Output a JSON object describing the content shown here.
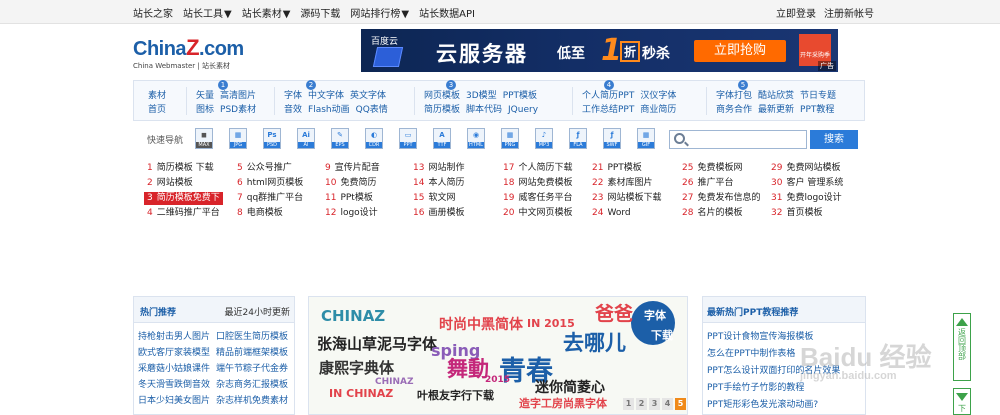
{
  "topnav": {
    "items": [
      {
        "label": "站长之家",
        "dropdown": false
      },
      {
        "label": "站长工具",
        "dropdown": true
      },
      {
        "label": "站长素材",
        "dropdown": true
      },
      {
        "label": "源码下载",
        "dropdown": false
      },
      {
        "label": "网站排行榜",
        "dropdown": true
      },
      {
        "label": "站长数据API",
        "dropdown": false
      }
    ],
    "login": "立即登录",
    "register": "注册新帐号"
  },
  "logo": {
    "main_a": "China",
    "main_z": "Z",
    "main_b": ".com",
    "sub": "China Webmaster | 站长素材"
  },
  "ad": {
    "brand": "百度云",
    "title": "云服务器",
    "low": "低至",
    "num": "1",
    "zhe": "折",
    "kill": "秒杀",
    "button": "立即抢购",
    "sign": "开年采购季",
    "tag": "广告"
  },
  "catnav": {
    "groups": [
      {
        "num": "",
        "rows": [
          [
            "素材"
          ],
          [
            "首页"
          ]
        ]
      },
      {
        "num": "1",
        "rows": [
          [
            "矢量",
            "高清图片"
          ],
          [
            "图标",
            "PSD素材"
          ]
        ]
      },
      {
        "num": "2",
        "rows": [
          [
            "字体",
            "中文字体",
            "英文字体"
          ],
          [
            "音效",
            "Flash动画",
            "QQ表情"
          ]
        ]
      },
      {
        "num": "3",
        "rows": [
          [
            "网页模板",
            "3D模型",
            "PPT模板"
          ],
          [
            "简历模板",
            "脚本代码",
            "JQuery"
          ]
        ]
      },
      {
        "num": "4",
        "rows": [
          [
            "个人简历PPT",
            "汉仪字体"
          ],
          [
            "工作总结PPT",
            "商业简历"
          ]
        ]
      },
      {
        "num": "5",
        "rows": [
          [
            "字体打包",
            "酷站欣赏",
            "节日专题"
          ],
          [
            "商务合作",
            "最新更新",
            "PPT教程"
          ]
        ]
      }
    ]
  },
  "quick": {
    "label": "快速导航",
    "icons": [
      {
        "name": "max-icon",
        "glyph": "◼",
        "cap": "MAX",
        "color": "#555555"
      },
      {
        "name": "jpg-icon",
        "glyph": "▦",
        "cap": "JPG",
        "color": "#2b7bd9"
      },
      {
        "name": "psd-icon",
        "glyph": "Ps",
        "cap": "PSD",
        "color": "#2b7bd9"
      },
      {
        "name": "ai-icon",
        "glyph": "Ai",
        "cap": "AI",
        "color": "#2b7bd9"
      },
      {
        "name": "eps-icon",
        "glyph": "✎",
        "cap": "EPS",
        "color": "#2b7bd9"
      },
      {
        "name": "cdr-icon",
        "glyph": "◐",
        "cap": "CDR",
        "color": "#2b7bd9"
      },
      {
        "name": "ppt-icon",
        "glyph": "▭",
        "cap": "PPT",
        "color": "#2b7bd9"
      },
      {
        "name": "ttf-icon",
        "glyph": "A",
        "cap": "TTF",
        "color": "#2b7bd9"
      },
      {
        "name": "html-icon",
        "glyph": "◉",
        "cap": "HTML",
        "color": "#2b7bd9"
      },
      {
        "name": "png-icon",
        "glyph": "▦",
        "cap": "PNG",
        "color": "#2b7bd9"
      },
      {
        "name": "mp3-icon",
        "glyph": "♪",
        "cap": "MP3",
        "color": "#2b7bd9"
      },
      {
        "name": "fla-icon",
        "glyph": "ƒ",
        "cap": "FLA",
        "color": "#2b7bd9"
      },
      {
        "name": "swf-icon",
        "glyph": "ƒ",
        "cap": "SWF",
        "color": "#2b7bd9"
      },
      {
        "name": "gif-icon",
        "glyph": "▦",
        "cap": "GIF",
        "color": "#2b7bd9"
      }
    ]
  },
  "search": {
    "value": "",
    "placeholder": "",
    "button": "搜索"
  },
  "ranking": [
    {
      "n": "1",
      "t": "简历模板 下载",
      "hl": false
    },
    {
      "n": "2",
      "t": "网站模板",
      "hl": false
    },
    {
      "n": "3",
      "t": "简历模板免费下",
      "hl": true
    },
    {
      "n": "4",
      "t": "二维码推广平台",
      "hl": false
    },
    {
      "n": "5",
      "t": "公众号推广",
      "hl": false
    },
    {
      "n": "6",
      "t": "html网页模板",
      "hl": false
    },
    {
      "n": "7",
      "t": "qq群推广平台",
      "hl": false
    },
    {
      "n": "8",
      "t": "电商模板",
      "hl": false
    },
    {
      "n": "9",
      "t": "宣传片配音",
      "hl": false
    },
    {
      "n": "10",
      "t": "免费简历",
      "hl": false
    },
    {
      "n": "11",
      "t": "PPt模板",
      "hl": false
    },
    {
      "n": "12",
      "t": "logo设计",
      "hl": false
    },
    {
      "n": "13",
      "t": "网站制作",
      "hl": false
    },
    {
      "n": "14",
      "t": "本人简历",
      "hl": false
    },
    {
      "n": "15",
      "t": "软文网",
      "hl": false
    },
    {
      "n": "16",
      "t": "画册模板",
      "hl": false
    },
    {
      "n": "17",
      "t": "个人简历下载",
      "hl": false
    },
    {
      "n": "18",
      "t": "网站免费模板",
      "hl": false
    },
    {
      "n": "19",
      "t": "威客任务平台",
      "hl": false
    },
    {
      "n": "20",
      "t": "中文网页模板",
      "hl": false
    },
    {
      "n": "21",
      "t": "PPT模板",
      "hl": false
    },
    {
      "n": "22",
      "t": "素材库图片",
      "hl": false
    },
    {
      "n": "23",
      "t": "网站模板下载",
      "hl": false
    },
    {
      "n": "24",
      "t": "Word",
      "hl": false
    },
    {
      "n": "25",
      "t": "免费模板网",
      "hl": false
    },
    {
      "n": "26",
      "t": "推广平台",
      "hl": false
    },
    {
      "n": "27",
      "t": "免费发布信息的",
      "hl": false
    },
    {
      "n": "28",
      "t": "名片的模板",
      "hl": false
    },
    {
      "n": "29",
      "t": "免费网站模板",
      "hl": false
    },
    {
      "n": "30",
      "t": "客户 管理系统",
      "hl": false
    },
    {
      "n": "31",
      "t": "免费logo设计",
      "hl": false
    },
    {
      "n": "32",
      "t": "首页模板",
      "hl": false
    }
  ],
  "hot": {
    "title": "热门推荐",
    "right": "最近24小时更新",
    "items": [
      "持枪射击男人图片",
      "口腔医生简历模板",
      "欧式客厅家装模型",
      "精品前端框架模板",
      "采蘑菇小姑娘课件",
      "端午节粽子代金券",
      "冬天滑雪跌倒音效",
      "杂志商务汇报模板",
      "日本少妇美女图片",
      "杂志样机免费素材"
    ]
  },
  "banner": {
    "words": [
      "CHINAZ",
      "时尚中黑简体",
      "IN 2015",
      "爸爸",
      "字体",
      "下载",
      "张海山草泥马字体",
      "sping",
      "去哪儿",
      "康熙字典体",
      "舞動",
      "青春",
      "CHINAZ",
      "2015",
      "迷你简菱心",
      "IN CHINAZ",
      "叶根友字行下载",
      "造字工房尚黑字体"
    ],
    "pages": [
      "1",
      "2",
      "3",
      "4",
      "5"
    ],
    "active": "5"
  },
  "ppt": {
    "title": "最新热门PPT教程推荐",
    "items": [
      "PPT设计食物宣传海报模板",
      "怎么在PPT中制作表格",
      "PPT怎么设计双面打印的名片效果",
      "PPT手绘竹子竹影的教程",
      "PPT矩形彩色发光滚动动画?"
    ]
  },
  "side": {
    "backtop": "返回顶部",
    "download": "下"
  },
  "watermark": {
    "main": "Baidu 经验",
    "sub": "jingyan.baidu.com"
  }
}
